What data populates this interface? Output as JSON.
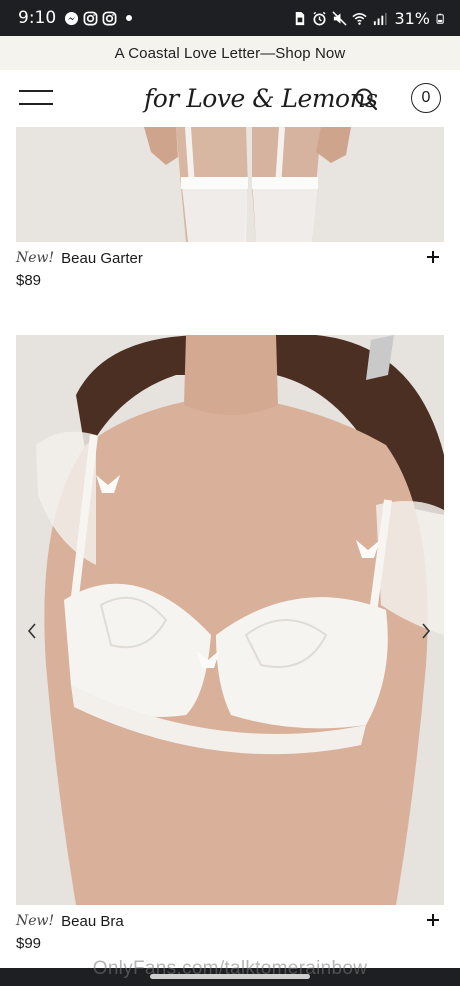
{
  "status_bar": {
    "time": "9:10",
    "battery": "31%",
    "left_icons": [
      "messenger-icon",
      "instagram-icon",
      "instagram-icon"
    ],
    "right_icons": [
      "sim-icon",
      "alarm-icon",
      "mute-icon",
      "wifi-icon",
      "signal-icon",
      "battery-icon"
    ]
  },
  "promo": {
    "text": "A Coastal Love Letter—Shop Now"
  },
  "header": {
    "logo": "for Love & Lemons",
    "cart_count": "0"
  },
  "products": [
    {
      "badge": "New!",
      "name": "Beau Garter",
      "price": "$89"
    },
    {
      "badge": "New!",
      "name": "Beau Bra",
      "price": "$99"
    }
  ],
  "watermark": "OnlyFans.com/talktomerainbow",
  "colors": {
    "status_bar_bg": "#1e1f22",
    "promo_bg": "#f4f3ee",
    "text": "#1a1a1a"
  }
}
